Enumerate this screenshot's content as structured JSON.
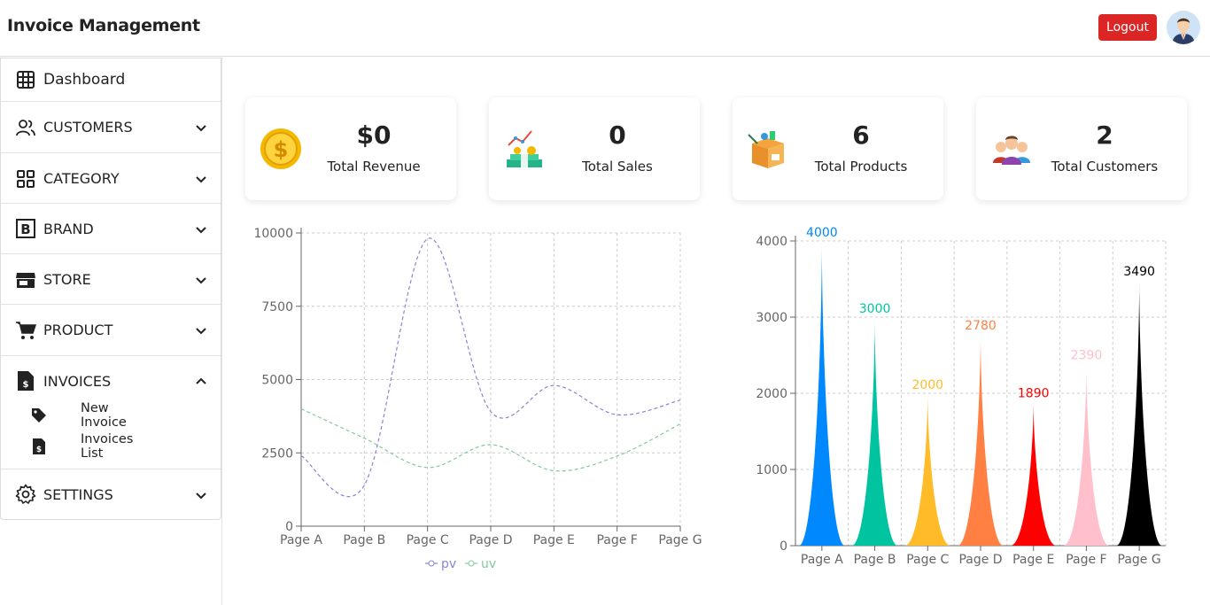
{
  "header": {
    "title": "Invoice Management",
    "logout_label": "Logout"
  },
  "sidebar": {
    "dashboard_label": "Dashboard",
    "items": [
      {
        "label": "CUSTOMERS"
      },
      {
        "label": "CATEGORY"
      },
      {
        "label": "BRAND"
      },
      {
        "label": "STORE"
      },
      {
        "label": "PRODUCT"
      },
      {
        "label": "INVOICES",
        "expanded": true,
        "children": [
          {
            "label": "New Invoice"
          },
          {
            "label": "Invoices List"
          }
        ]
      },
      {
        "label": "SETTINGS"
      }
    ]
  },
  "stats": [
    {
      "value": "$0",
      "caption": "Total Revenue",
      "icon": "dollar-coin-icon"
    },
    {
      "value": "0",
      "caption": "Total Sales",
      "icon": "sales-growth-icon"
    },
    {
      "value": "6",
      "caption": "Total Products",
      "icon": "product-box-icon"
    },
    {
      "value": "2",
      "caption": "Total Customers",
      "icon": "customers-group-icon"
    }
  ],
  "colors": {
    "logout": "#dc2626",
    "pv": "#8884d8",
    "uv": "#82ca9d"
  },
  "chart_data": [
    {
      "type": "line",
      "categories": [
        "Page A",
        "Page B",
        "Page C",
        "Page D",
        "Page E",
        "Page F",
        "Page G"
      ],
      "series": [
        {
          "name": "pv",
          "values": [
            2400,
            1398,
            9800,
            3908,
            4800,
            3800,
            4300
          ],
          "color": "#8884d8"
        },
        {
          "name": "uv",
          "values": [
            4000,
            3000,
            2000,
            2780,
            1890,
            2390,
            3490
          ],
          "color": "#82ca9d"
        }
      ],
      "yticks": [
        0,
        2500,
        5000,
        7500,
        10000
      ],
      "ylim": [
        0,
        10000
      ],
      "grid": true,
      "line_style": "dashed",
      "legend": "bottom-center"
    },
    {
      "type": "bar",
      "categories": [
        "Page A",
        "Page B",
        "Page C",
        "Page D",
        "Page E",
        "Page F",
        "Page G"
      ],
      "values": [
        4000,
        3000,
        2000,
        2780,
        1890,
        2390,
        3490
      ],
      "colors": [
        "#0088FE",
        "#00C49F",
        "#FFBB28",
        "#FF8042",
        "#ff0000",
        "#ffc0cb",
        "#000000"
      ],
      "yticks": [
        0,
        1000,
        2000,
        3000,
        4000
      ],
      "ylim": [
        0,
        4000
      ],
      "grid": true,
      "bar_shape": "triangle-spike",
      "data_labels": true
    }
  ]
}
